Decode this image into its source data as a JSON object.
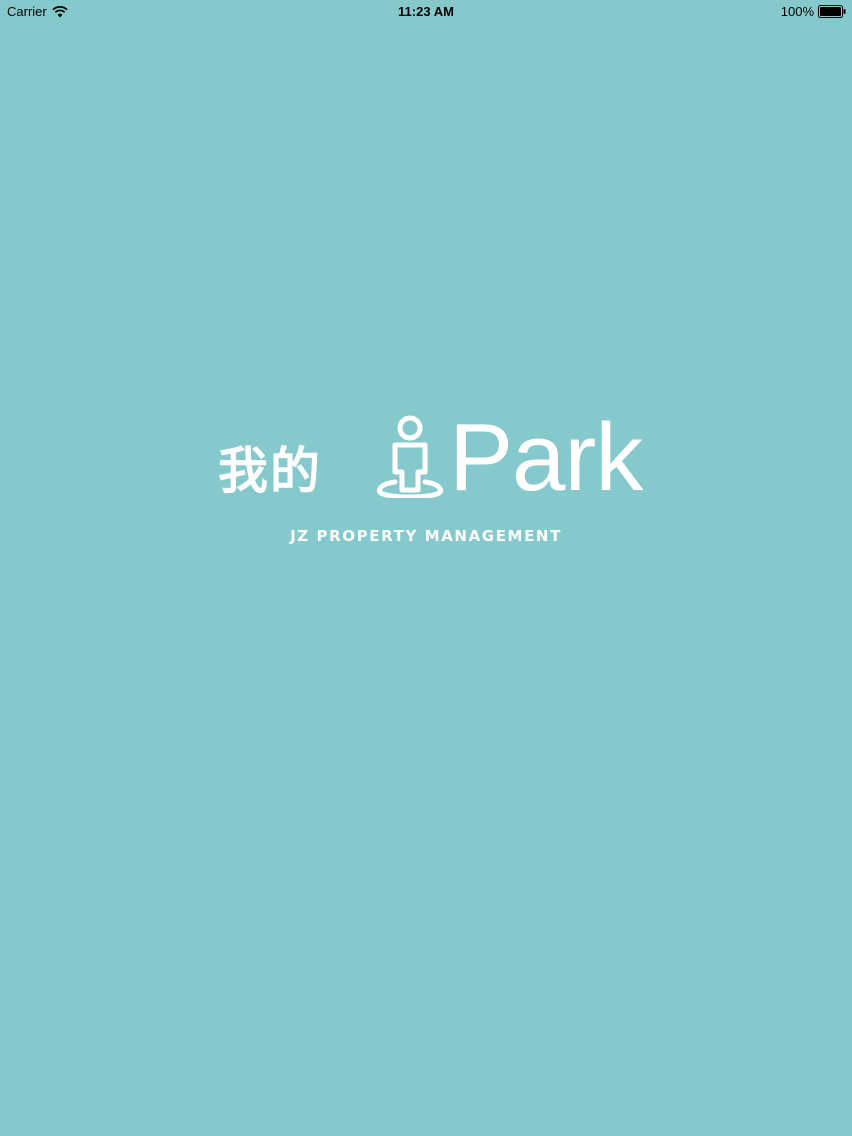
{
  "status_bar": {
    "carrier": "Carrier",
    "time": "11:23 AM",
    "battery_percent": "100%",
    "battery_level": 1.0
  },
  "logo": {
    "chinese_text": "我的",
    "park_text": "Park",
    "tagline": "JZ PROPERTY MANAGEMENT",
    "icon": "person-on-pin-icon"
  },
  "colors": {
    "background": "#86c9cc",
    "logo": "#ffffff",
    "status_text": "#000000"
  }
}
